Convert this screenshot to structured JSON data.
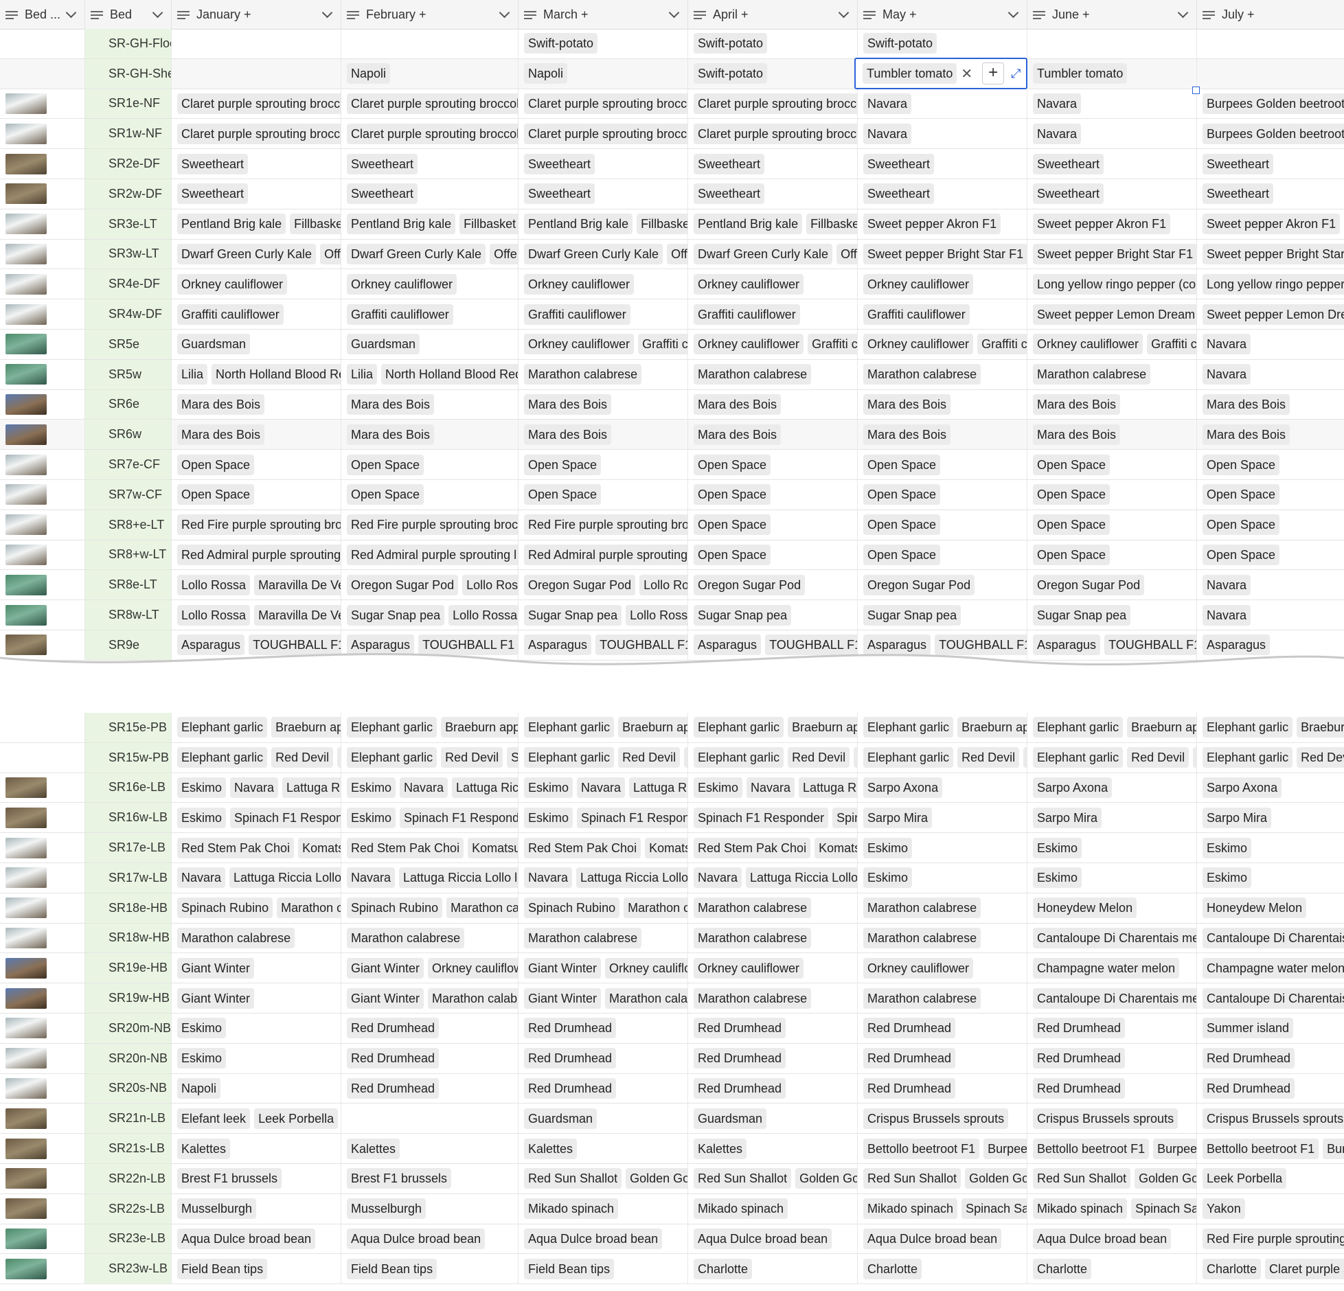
{
  "columns": [
    {
      "label": "Bed ..."
    },
    {
      "label": "Bed"
    },
    {
      "label": "January +"
    },
    {
      "label": "February +"
    },
    {
      "label": "March +"
    },
    {
      "label": "April +"
    },
    {
      "label": "May +"
    },
    {
      "label": "June +"
    },
    {
      "label": "July +"
    }
  ],
  "rows_top": [
    {
      "bed": "SR-GH-Floor",
      "thumb": "",
      "months": [
        [],
        [],
        [
          "Swift-potato"
        ],
        [
          "Swift-potato"
        ],
        [
          "Swift-potato"
        ],
        [],
        []
      ]
    },
    {
      "bed": "SR-GH-Shelves",
      "thumb": "",
      "months": [
        [],
        [
          "Napoli"
        ],
        [
          "Napoli"
        ],
        [
          "Swift-potato"
        ],
        [
          "Tumbler tomato"
        ],
        [
          "Tumbler tomato"
        ],
        []
      ]
    },
    {
      "bed": "SR1e-NF",
      "thumb": "t1",
      "months": [
        [
          "Claret purple sprouting broccoli"
        ],
        [
          "Claret purple sprouting broccoli"
        ],
        [
          "Claret purple sprouting broccoli"
        ],
        [
          "Claret purple sprouting broccoli"
        ],
        [
          "Navara"
        ],
        [
          "Navara"
        ],
        [
          "Burpees Golden beetroot"
        ]
      ]
    },
    {
      "bed": "SR1w-NF",
      "thumb": "t1",
      "months": [
        [
          "Claret purple sprouting broccoli"
        ],
        [
          "Claret purple sprouting broccoli"
        ],
        [
          "Claret purple sprouting broccoli"
        ],
        [
          "Claret purple sprouting broccoli"
        ],
        [
          "Navara"
        ],
        [
          "Navara"
        ],
        [
          "Burpees Golden beetroot"
        ]
      ]
    },
    {
      "bed": "SR2e-DF",
      "thumb": "t2",
      "months": [
        [
          "Sweetheart"
        ],
        [
          "Sweetheart"
        ],
        [
          "Sweetheart"
        ],
        [
          "Sweetheart"
        ],
        [
          "Sweetheart"
        ],
        [
          "Sweetheart"
        ],
        [
          "Sweetheart"
        ]
      ]
    },
    {
      "bed": "SR2w-DF",
      "thumb": "t2",
      "months": [
        [
          "Sweetheart"
        ],
        [
          "Sweetheart"
        ],
        [
          "Sweetheart"
        ],
        [
          "Sweetheart"
        ],
        [
          "Sweetheart"
        ],
        [
          "Sweetheart"
        ],
        [
          "Sweetheart"
        ]
      ]
    },
    {
      "bed": "SR3e-LT",
      "thumb": "t1",
      "months": [
        [
          "Pentland Brig kale",
          "Fillbasket"
        ],
        [
          "Pentland Brig kale",
          "Fillbasket B"
        ],
        [
          "Pentland Brig kale",
          "Fillbasket"
        ],
        [
          "Pentland Brig kale",
          "Fillbasket"
        ],
        [
          "Sweet pepper Akron F1"
        ],
        [
          "Sweet pepper Akron F1"
        ],
        [
          "Sweet pepper Akron F1"
        ]
      ]
    },
    {
      "bed": "SR3w-LT",
      "thumb": "t1",
      "months": [
        [
          "Dwarf Green Curly Kale",
          "Offer"
        ],
        [
          "Dwarf Green Curly Kale",
          "Offenb"
        ],
        [
          "Dwarf Green Curly Kale",
          "Offer"
        ],
        [
          "Dwarf Green Curly Kale",
          "Offer"
        ],
        [
          "Sweet pepper Bright Star F1"
        ],
        [
          "Sweet pepper Bright Star F1"
        ],
        [
          "Sweet pepper Bright Star F1"
        ]
      ]
    },
    {
      "bed": "SR4e-DF",
      "thumb": "t1",
      "months": [
        [
          "Orkney cauliflower"
        ],
        [
          "Orkney cauliflower"
        ],
        [
          "Orkney cauliflower"
        ],
        [
          "Orkney cauliflower"
        ],
        [
          "Orkney cauliflower"
        ],
        [
          "Long yellow ringo pepper (co"
        ],
        [
          "Long yellow ringo pepper"
        ]
      ]
    },
    {
      "bed": "SR4w-DF",
      "thumb": "t1",
      "months": [
        [
          "Graffiti cauliflower"
        ],
        [
          "Graffiti cauliflower"
        ],
        [
          "Graffiti cauliflower"
        ],
        [
          "Graffiti cauliflower"
        ],
        [
          "Graffiti cauliflower"
        ],
        [
          "Sweet pepper Lemon Dream"
        ],
        [
          "Sweet pepper Lemon Dream"
        ]
      ]
    },
    {
      "bed": "SR5e",
      "thumb": "t3",
      "months": [
        [
          "Guardsman"
        ],
        [
          "Guardsman"
        ],
        [
          "Orkney cauliflower",
          "Graffiti ca"
        ],
        [
          "Orkney cauliflower",
          "Graffiti ca"
        ],
        [
          "Orkney cauliflower",
          "Graffiti ca"
        ],
        [
          "Orkney cauliflower",
          "Graffiti ca"
        ],
        [
          "Navara"
        ]
      ]
    },
    {
      "bed": "SR5w",
      "thumb": "t3",
      "months": [
        [
          "Lilia",
          "North Holland Blood Re"
        ],
        [
          "Lilia",
          "North Holland Blood Red"
        ],
        [
          "Marathon calabrese"
        ],
        [
          "Marathon calabrese"
        ],
        [
          "Marathon calabrese"
        ],
        [
          "Marathon calabrese"
        ],
        [
          "Navara"
        ]
      ]
    },
    {
      "bed": "SR6e",
      "thumb": "t4",
      "months": [
        [
          "Mara des Bois"
        ],
        [
          "Mara des Bois"
        ],
        [
          "Mara des Bois"
        ],
        [
          "Mara des Bois"
        ],
        [
          "Mara des Bois"
        ],
        [
          "Mara des Bois"
        ],
        [
          "Mara des Bois"
        ]
      ]
    },
    {
      "bed": "SR6w",
      "thumb": "t4",
      "months": [
        [
          "Mara des Bois"
        ],
        [
          "Mara des Bois"
        ],
        [
          "Mara des Bois"
        ],
        [
          "Mara des Bois"
        ],
        [
          "Mara des Bois"
        ],
        [
          "Mara des Bois"
        ],
        [
          "Mara des Bois"
        ]
      ]
    },
    {
      "bed": "SR7e-CF",
      "thumb": "t1",
      "months": [
        [
          "Open Space"
        ],
        [
          "Open Space"
        ],
        [
          "Open Space"
        ],
        [
          "Open Space"
        ],
        [
          "Open Space"
        ],
        [
          "Open Space"
        ],
        [
          "Open Space"
        ]
      ]
    },
    {
      "bed": "SR7w-CF",
      "thumb": "t1",
      "months": [
        [
          "Open Space"
        ],
        [
          "Open Space"
        ],
        [
          "Open Space"
        ],
        [
          "Open Space"
        ],
        [
          "Open Space"
        ],
        [
          "Open Space"
        ],
        [
          "Open Space"
        ]
      ]
    },
    {
      "bed": "SR8+e-LT",
      "thumb": "t1",
      "months": [
        [
          "Red Fire purple sprouting broccoli"
        ],
        [
          "Red Fire purple sprouting broccoli"
        ],
        [
          "Red Fire purple sprouting broccoli"
        ],
        [
          "Open Space"
        ],
        [
          "Open Space"
        ],
        [
          "Open Space"
        ],
        [
          "Open Space"
        ]
      ]
    },
    {
      "bed": "SR8+w-LT",
      "thumb": "t1",
      "months": [
        [
          "Red Admiral purple sprouting"
        ],
        [
          "Red Admiral purple sprouting l"
        ],
        [
          "Red Admiral purple sprouting"
        ],
        [
          "Open Space"
        ],
        [
          "Open Space"
        ],
        [
          "Open Space"
        ],
        [
          "Open Space"
        ]
      ]
    },
    {
      "bed": "SR8e-LT",
      "thumb": "t3",
      "months": [
        [
          "Lollo Rossa",
          "Maravilla De Vera"
        ],
        [
          "Oregon Sugar Pod",
          "Lollo Rossa"
        ],
        [
          "Oregon Sugar Pod",
          "Lollo Ros"
        ],
        [
          "Oregon Sugar Pod"
        ],
        [
          "Oregon Sugar Pod"
        ],
        [
          "Oregon Sugar Pod"
        ],
        [
          "Navara"
        ]
      ]
    },
    {
      "bed": "SR8w-LT",
      "thumb": "t3",
      "months": [
        [
          "Lollo Rossa",
          "Maravilla De Vera"
        ],
        [
          "Sugar Snap pea",
          "Lollo Rossa"
        ],
        [
          "Sugar Snap pea",
          "Lollo Rossa"
        ],
        [
          "Sugar Snap pea"
        ],
        [
          "Sugar Snap pea"
        ],
        [
          "Sugar Snap pea"
        ],
        [
          "Navara"
        ]
      ]
    },
    {
      "bed": "SR9e",
      "thumb": "t2",
      "months": [
        [
          "Asparagus",
          "TOUGHBALL F1"
        ],
        [
          "Asparagus",
          "TOUGHBALL F1"
        ],
        [
          "Asparagus",
          "TOUGHBALL F1"
        ],
        [
          "Asparagus",
          "TOUGHBALL F1"
        ],
        [
          "Asparagus",
          "TOUGHBALL F1"
        ],
        [
          "Asparagus",
          "TOUGHBALL F1"
        ],
        [
          "Asparagus"
        ]
      ]
    }
  ],
  "rows_bottom": [
    {
      "bed": "SR15e-PB",
      "thumb": "",
      "months": [
        [
          "Elephant garlic",
          "Braeburn app"
        ],
        [
          "Elephant garlic",
          "Braeburn apple"
        ],
        [
          "Elephant garlic",
          "Braeburn app"
        ],
        [
          "Elephant garlic",
          "Braeburn app"
        ],
        [
          "Elephant garlic",
          "Braeburn app"
        ],
        [
          "Elephant garlic",
          "Braeburn app"
        ],
        [
          "Elephant garlic",
          "Braeburn"
        ]
      ]
    },
    {
      "bed": "SR15w-PB",
      "thumb": "",
      "months": [
        [
          "Elephant garlic",
          "Red Devil",
          "St"
        ],
        [
          "Elephant garlic",
          "Red Devil",
          "Sta"
        ],
        [
          "Elephant garlic",
          "Red Devil",
          "St"
        ],
        [
          "Elephant garlic",
          "Red Devil",
          "St"
        ],
        [
          "Elephant garlic",
          "Red Devil",
          "St"
        ],
        [
          "Elephant garlic",
          "Red Devil",
          "St"
        ],
        [
          "Elephant garlic",
          "Red Devil"
        ]
      ]
    },
    {
      "bed": "SR16e-LB",
      "thumb": "t2",
      "months": [
        [
          "Eskimo",
          "Navara",
          "Lattuga Ricc"
        ],
        [
          "Eskimo",
          "Navara",
          "Lattuga Riccia"
        ],
        [
          "Eskimo",
          "Navara",
          "Lattuga Ricc"
        ],
        [
          "Eskimo",
          "Navara",
          "Lattuga Ricc"
        ],
        [
          "Sarpo Axona"
        ],
        [
          "Sarpo Axona"
        ],
        [
          "Sarpo Axona"
        ]
      ]
    },
    {
      "bed": "SR16w-LB",
      "thumb": "t2",
      "months": [
        [
          "Eskimo",
          "Spinach F1 Responder"
        ],
        [
          "Eskimo",
          "Spinach F1 Responder"
        ],
        [
          "Eskimo",
          "Spinach F1 Responder"
        ],
        [
          "Spinach F1 Responder",
          "Spina"
        ],
        [
          "Sarpo Mira"
        ],
        [
          "Sarpo Mira"
        ],
        [
          "Sarpo Mira"
        ]
      ]
    },
    {
      "bed": "SR17e-LB",
      "thumb": "t1",
      "months": [
        [
          "Red Stem Pak Choi",
          "Komatsu"
        ],
        [
          "Red Stem Pak Choi",
          "Komatsum"
        ],
        [
          "Red Stem Pak Choi",
          "Komatsu"
        ],
        [
          "Red Stem Pak Choi",
          "Komatsu"
        ],
        [
          "Eskimo"
        ],
        [
          "Eskimo"
        ],
        [
          "Eskimo"
        ]
      ]
    },
    {
      "bed": "SR17w-LB",
      "thumb": "t1",
      "months": [
        [
          "Navara",
          "Lattuga Riccia Lollo le"
        ],
        [
          "Navara",
          "Lattuga Riccia Lollo let"
        ],
        [
          "Navara",
          "Lattuga Riccia Lollo l"
        ],
        [
          "Navara",
          "Lattuga Riccia Lollo l"
        ],
        [
          "Eskimo"
        ],
        [
          "Eskimo"
        ],
        [
          "Eskimo"
        ]
      ]
    },
    {
      "bed": "SR18e-HB",
      "thumb": "t1",
      "months": [
        [
          "Spinach Rubino",
          "Marathon ca"
        ],
        [
          "Spinach Rubino",
          "Marathon cal"
        ],
        [
          "Spinach Rubino",
          "Marathon ca"
        ],
        [
          "Marathon calabrese"
        ],
        [
          "Marathon calabrese"
        ],
        [
          "Honeydew Melon"
        ],
        [
          "Honeydew Melon"
        ]
      ]
    },
    {
      "bed": "SR18w-HB",
      "thumb": "t1",
      "months": [
        [
          "Marathon calabrese"
        ],
        [
          "Marathon calabrese"
        ],
        [
          "Marathon calabrese"
        ],
        [
          "Marathon calabrese"
        ],
        [
          "Marathon calabrese"
        ],
        [
          "Cantaloupe Di Charentais me"
        ],
        [
          "Cantaloupe Di Charentais"
        ]
      ]
    },
    {
      "bed": "SR19e-HB",
      "thumb": "t4",
      "months": [
        [
          "Giant Winter"
        ],
        [
          "Giant Winter",
          "Orkney cauliflow"
        ],
        [
          "Giant Winter",
          "Orkney cauliflo"
        ],
        [
          "Orkney cauliflower"
        ],
        [
          "Orkney cauliflower"
        ],
        [
          "Champagne water melon"
        ],
        [
          "Champagne water melon"
        ]
      ]
    },
    {
      "bed": "SR19w-HB",
      "thumb": "t4",
      "months": [
        [
          "Giant Winter"
        ],
        [
          "Giant Winter",
          "Marathon calabr"
        ],
        [
          "Giant Winter",
          "Marathon calab"
        ],
        [
          "Marathon calabrese"
        ],
        [
          "Marathon calabrese"
        ],
        [
          "Cantaloupe Di Charentais me"
        ],
        [
          "Cantaloupe Di Charentais"
        ]
      ]
    },
    {
      "bed": "SR20m-NB",
      "thumb": "t1",
      "months": [
        [
          "Eskimo"
        ],
        [
          "Red Drumhead"
        ],
        [
          "Red Drumhead"
        ],
        [
          "Red Drumhead"
        ],
        [
          "Red Drumhead"
        ],
        [
          "Red Drumhead"
        ],
        [
          "Summer island"
        ]
      ]
    },
    {
      "bed": "SR20n-NB",
      "thumb": "t1",
      "months": [
        [
          "Eskimo"
        ],
        [
          "Red Drumhead"
        ],
        [
          "Red Drumhead"
        ],
        [
          "Red Drumhead"
        ],
        [
          "Red Drumhead"
        ],
        [
          "Red Drumhead"
        ],
        [
          "Red Drumhead"
        ]
      ]
    },
    {
      "bed": "SR20s-NB",
      "thumb": "t1",
      "months": [
        [
          "Napoli"
        ],
        [
          "Red Drumhead"
        ],
        [
          "Red Drumhead"
        ],
        [
          "Red Drumhead"
        ],
        [
          "Red Drumhead"
        ],
        [
          "Red Drumhead"
        ],
        [
          "Red Drumhead"
        ]
      ]
    },
    {
      "bed": "SR21n-LB",
      "thumb": "t2",
      "months": [
        [
          "Elefant leek",
          "Leek Porbella"
        ],
        [],
        [
          "Guardsman"
        ],
        [
          "Guardsman"
        ],
        [
          "Crispus Brussels sprouts"
        ],
        [
          "Crispus Brussels sprouts"
        ],
        [
          "Crispus Brussels sprouts"
        ]
      ]
    },
    {
      "bed": "SR21s-LB",
      "thumb": "t2",
      "months": [
        [
          "Kalettes"
        ],
        [
          "Kalettes"
        ],
        [
          "Kalettes"
        ],
        [
          "Kalettes"
        ],
        [
          "Bettollo beetroot F1",
          "Burpees"
        ],
        [
          "Bettollo beetroot F1",
          "Burpees"
        ],
        [
          "Bettollo beetroot F1",
          "Burp"
        ]
      ]
    },
    {
      "bed": "SR22n-LB",
      "thumb": "t2",
      "months": [
        [
          "Brest F1 brussels"
        ],
        [
          "Brest F1 brussels"
        ],
        [
          "Red Sun Shallot",
          "Golden Gou"
        ],
        [
          "Red Sun Shallot",
          "Golden Gou"
        ],
        [
          "Red Sun Shallot",
          "Golden Gou"
        ],
        [
          "Red Sun Shallot",
          "Golden Gou"
        ],
        [
          "Leek Porbella"
        ]
      ]
    },
    {
      "bed": "SR22s-LB",
      "thumb": "t2",
      "months": [
        [
          "Musselburgh"
        ],
        [
          "Musselburgh"
        ],
        [
          "Mikado spinach"
        ],
        [
          "Mikado spinach"
        ],
        [
          "Mikado spinach",
          "Spinach San"
        ],
        [
          "Mikado spinach",
          "Spinach San"
        ],
        [
          "Yakon"
        ]
      ]
    },
    {
      "bed": "SR23e-LB",
      "thumb": "t3",
      "months": [
        [
          "Aqua Dulce broad bean"
        ],
        [
          "Aqua Dulce broad bean"
        ],
        [
          "Aqua Dulce broad bean"
        ],
        [
          "Aqua Dulce broad bean"
        ],
        [
          "Aqua Dulce broad bean"
        ],
        [
          "Aqua Dulce broad bean"
        ],
        [
          "Red Fire purple sprouting"
        ]
      ]
    },
    {
      "bed": "SR23w-LB",
      "thumb": "t3",
      "months": [
        [
          "Field Bean tips"
        ],
        [
          "Field Bean tips"
        ],
        [
          "Field Bean tips"
        ],
        [
          "Charlotte"
        ],
        [
          "Charlotte"
        ],
        [
          "Charlotte"
        ],
        [
          "Charlotte",
          "Claret purple sp"
        ]
      ]
    }
  ],
  "selected_cell": {
    "value": "Tumbler tomato",
    "plus": "+",
    "remove_icon": "close-icon",
    "expand_icon": "expand-icon"
  }
}
